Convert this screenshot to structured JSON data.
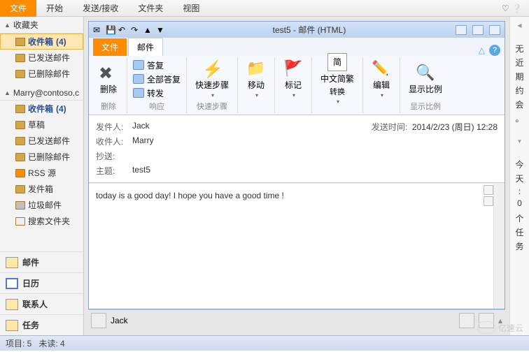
{
  "topRibbon": {
    "file": "文件",
    "tabs": [
      "开始",
      "发送/接收",
      "文件夹",
      "视图"
    ]
  },
  "nav": {
    "favorites": "收藏夹",
    "favItems": [
      {
        "label": "收件箱",
        "count": "(4)",
        "bold": true,
        "sel": true
      },
      {
        "label": "已发送邮件"
      },
      {
        "label": "已删除邮件"
      }
    ],
    "account": "Marry@contoso.c",
    "acctItems": [
      {
        "label": "收件箱",
        "count": "(4)",
        "bold": true
      },
      {
        "label": "草稿"
      },
      {
        "label": "已发送邮件"
      },
      {
        "label": "已删除邮件"
      },
      {
        "label": "RSS 源",
        "ico": "rss"
      },
      {
        "label": "发件箱"
      },
      {
        "label": "垃圾邮件",
        "ico": "trash"
      },
      {
        "label": "搜索文件夹",
        "ico": "search"
      }
    ],
    "bottom": [
      "邮件",
      "日历",
      "联系人",
      "任务"
    ]
  },
  "msg": {
    "winTitle": "test5 - 邮件 (HTML)",
    "tabFile": "文件",
    "tabMail": "邮件",
    "groups": {
      "delete": {
        "btn": "删除",
        "label": "删除"
      },
      "respond": {
        "reply": "答复",
        "replyAll": "全部答复",
        "fwd": "转发",
        "label": "响应"
      },
      "quick": {
        "btn": "快速步骤",
        "label": "快速步骤"
      },
      "move": {
        "btn": "移动"
      },
      "flag": {
        "btn": "标记"
      },
      "convert": {
        "btn": "中文简繁",
        "btn2": "转换",
        "sym": "简"
      },
      "edit": {
        "btn": "编辑"
      },
      "zoom": {
        "btn": "显示比例",
        "label": "显示比例"
      }
    },
    "header": {
      "fromLbl": "发件人:",
      "from": "Jack",
      "sentLbl": "发送时间:",
      "sent": "2014/2/23 (周日) 12:28",
      "toLbl": "收件人:",
      "to": "Marry",
      "ccLbl": "抄送:",
      "subjLbl": "主题:",
      "subj": "test5"
    },
    "body": "today is a good day! I hope you have a good time !",
    "footer": {
      "name": "Jack"
    }
  },
  "right": {
    "strip1": [
      "无",
      "近",
      "期",
      "约",
      "会",
      "。"
    ],
    "strip2": [
      "今",
      "天",
      ":",
      "0",
      " ",
      "个",
      "任",
      "务"
    ]
  },
  "status": {
    "items": "项目: 5",
    "unread": "未读: 4"
  },
  "watermark": "亿速云"
}
